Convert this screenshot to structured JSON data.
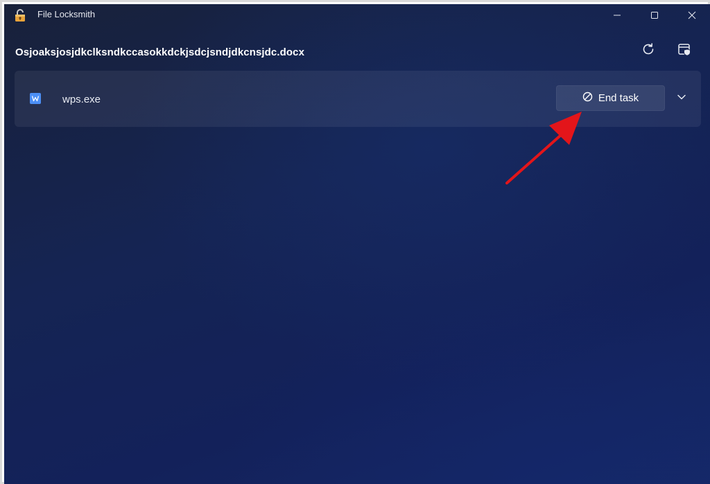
{
  "window": {
    "title": "File Locksmith",
    "app_icon": "padlock-icon",
    "controls": {
      "minimize_icon": "minimize-icon",
      "maximize_icon": "maximize-icon",
      "close_icon": "close-icon"
    }
  },
  "header": {
    "file_name": "Osjoaksjosjdkclksndkccasokkdckjsdcjsndjdkcnsjdc.docx",
    "refresh_icon": "refresh-icon",
    "admin_icon": "restart-as-admin-icon"
  },
  "processes": [
    {
      "name": "wps.exe",
      "icon": "wps-writer-icon",
      "end_task_label": "End task",
      "end_task_icon": "block-icon",
      "expand_icon": "chevron-down-icon"
    }
  ],
  "annotation": {
    "type": "arrow",
    "color": "#e3151a",
    "points_to": "End task"
  },
  "colors": {
    "background": "#152453",
    "row_background": "#2a334f",
    "text": "#ffffff",
    "accent_icon": "#4c8ff5",
    "annotation": "#e3151a"
  }
}
